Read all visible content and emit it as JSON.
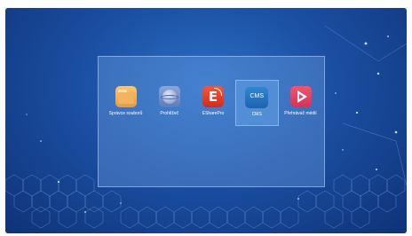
{
  "desktop": {
    "background_colors": [
      "#2b6fc4",
      "#1b4fa2",
      "#0f3278"
    ],
    "panel_color": "#6ea0e1"
  },
  "apps": [
    {
      "label": "Správce souborů",
      "icon": "folder-icon",
      "color": "#e69a3c"
    },
    {
      "label": "Prohlížeč",
      "icon": "browser-globe-icon",
      "color": "#6f89c2"
    },
    {
      "label": "ESharePro",
      "icon": "eshare-icon",
      "color": "#d9281b",
      "icon_text": "E"
    },
    {
      "label": "CMS",
      "icon": "cms-icon",
      "color": "#1f63b0",
      "icon_text": "CMS",
      "selected": true
    },
    {
      "label": "Přehrávač médií",
      "icon": "media-player-icon",
      "color": "#dc2f56"
    }
  ]
}
